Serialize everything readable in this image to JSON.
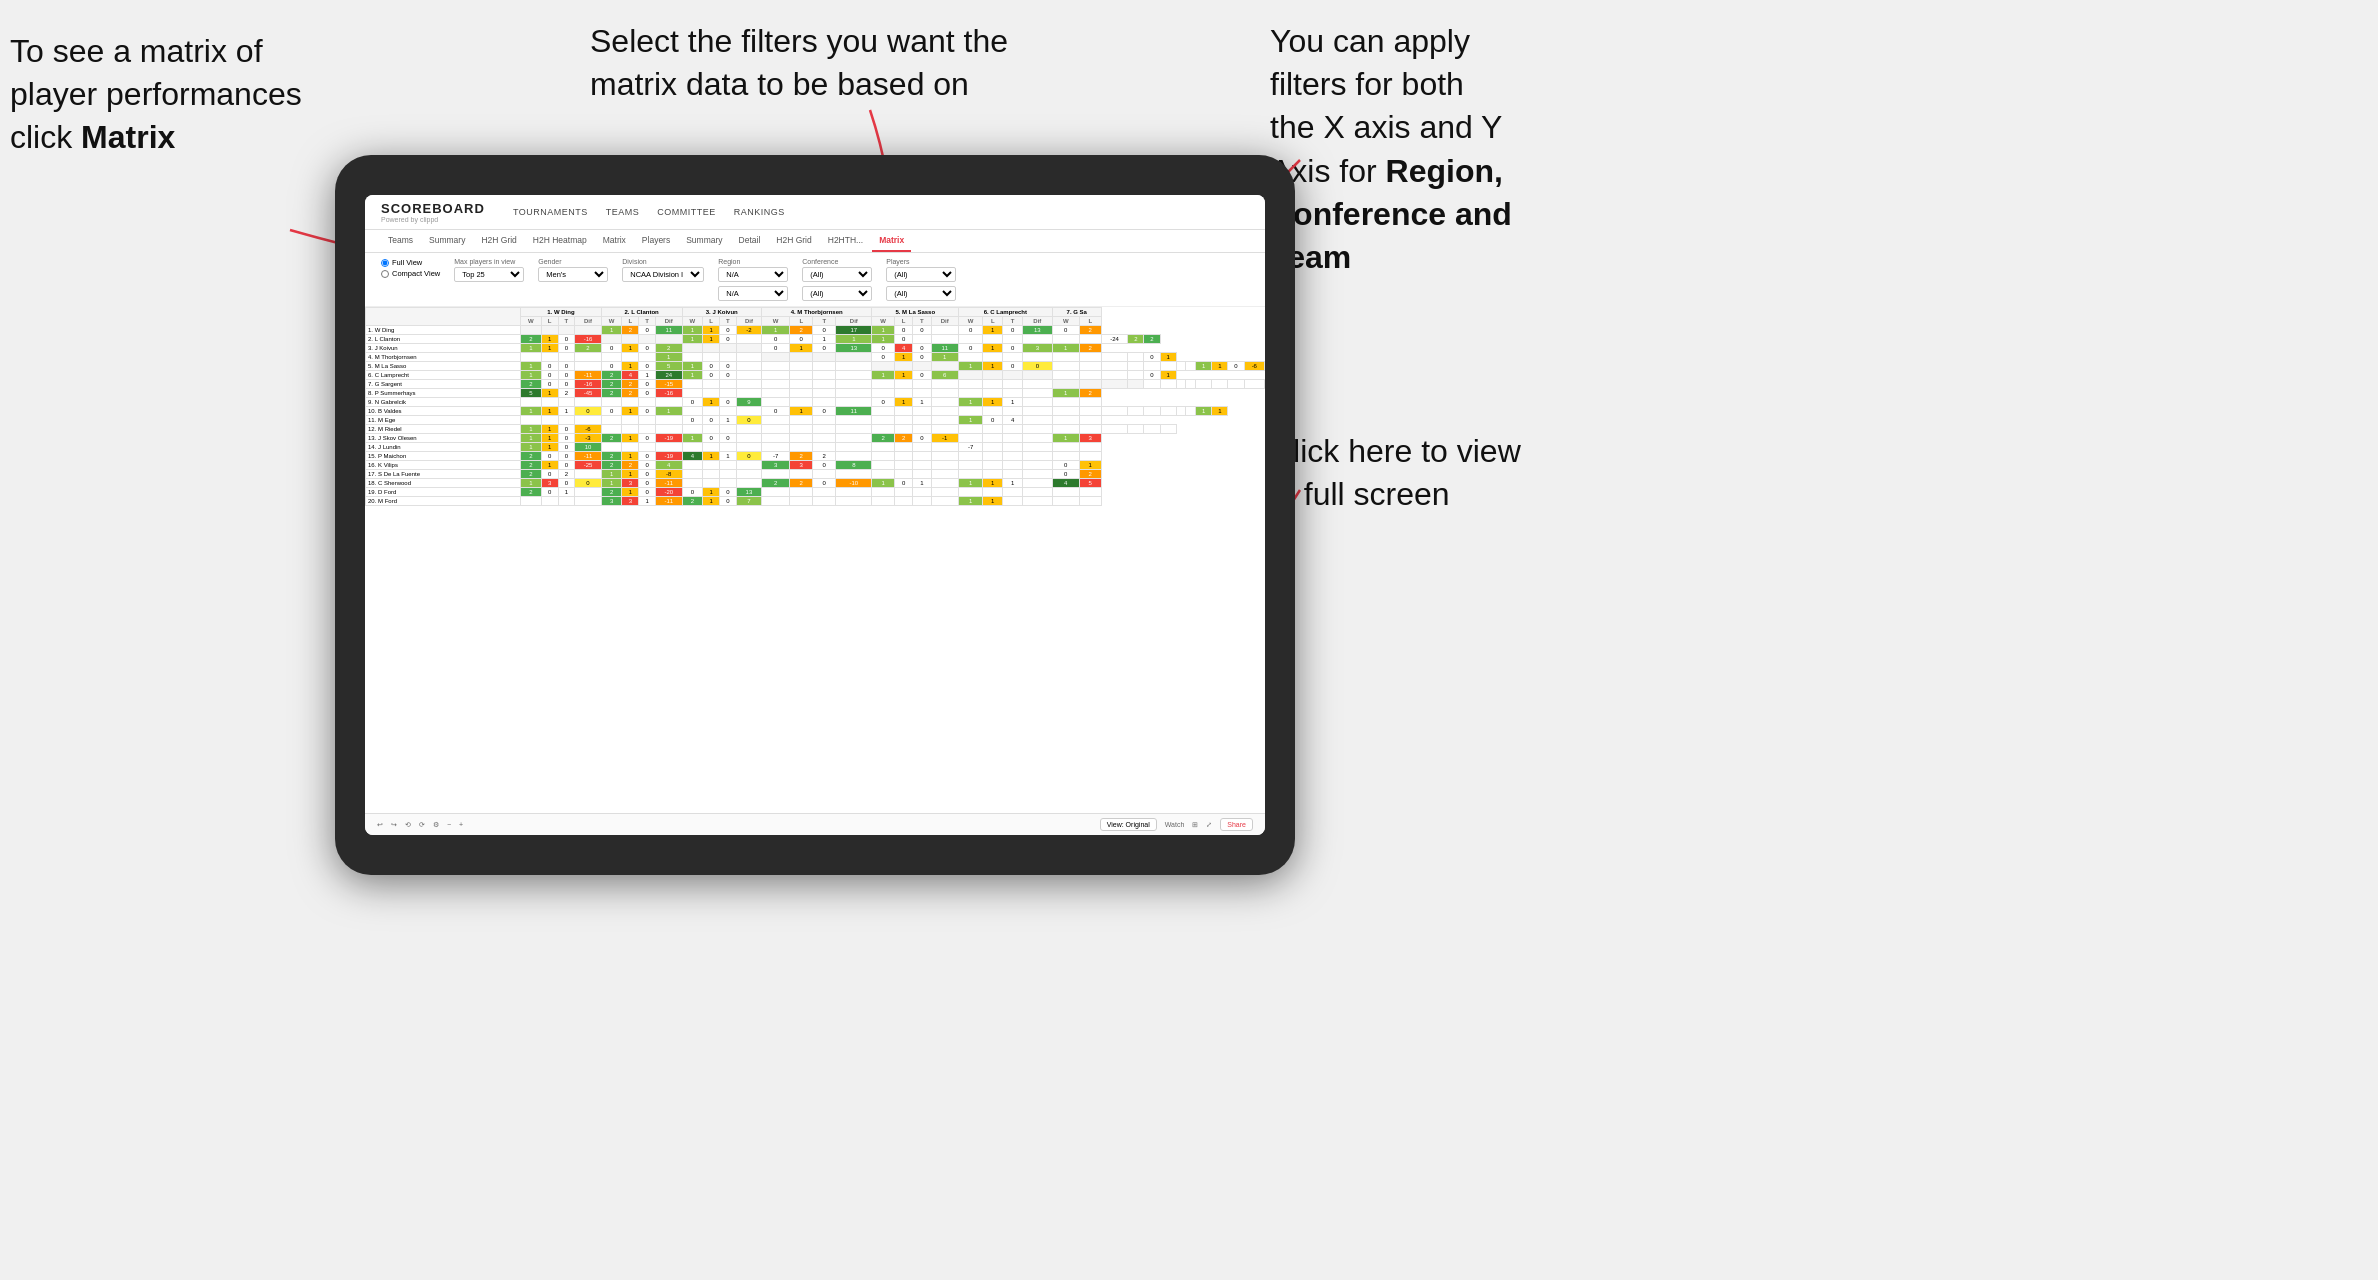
{
  "annotations": {
    "left": {
      "line1": "To see a matrix of",
      "line2": "player performances",
      "line3_normal": "click ",
      "line3_bold": "Matrix"
    },
    "center": {
      "text": "Select the filters you want the matrix data to be based on"
    },
    "right": {
      "line1": "You  can apply",
      "line2": "filters for both",
      "line3": "the X axis and Y",
      "line4_normal": "Axis for ",
      "line4_bold": "Region,",
      "line5_bold": "Conference and",
      "line6_bold": "Team"
    },
    "bottom_right": {
      "line1": "Click here to view",
      "line2": "in full screen"
    }
  },
  "app": {
    "logo": "SCOREBOARD",
    "logo_sub": "Powered by clippd",
    "nav": [
      "TOURNAMENTS",
      "TEAMS",
      "COMMITTEE",
      "RANKINGS"
    ],
    "sub_nav": [
      "Teams",
      "Summary",
      "H2H Grid",
      "H2H Heatmap",
      "Matrix",
      "Players",
      "Summary",
      "Detail",
      "H2H Grid",
      "H2HTH...",
      "Matrix"
    ],
    "active_tab": "Matrix",
    "filters": {
      "view": [
        "Full View",
        "Compact View"
      ],
      "max_players_label": "Max players in view",
      "max_players_value": "Top 25",
      "gender_label": "Gender",
      "gender_value": "Men's",
      "division_label": "Division",
      "division_value": "NCAA Division I",
      "region_label": "Region",
      "region_value": "N/A",
      "conference_label": "Conference",
      "conference_value": "(All)",
      "players_label": "Players",
      "players_value": "(All)"
    },
    "column_headers": [
      "1. W Ding",
      "2. L Clanton",
      "3. J Koivun",
      "4. M Thorbjornsen",
      "5. M La Sasso",
      "6. C Lamprecht",
      "7. G Sa"
    ],
    "sub_cols": [
      "W",
      "L",
      "T",
      "Dif"
    ],
    "rows": [
      {
        "name": "1. W Ding",
        "cells": [
          "",
          "",
          "",
          "",
          "1",
          "2",
          "0",
          "11",
          "1",
          "1",
          "0",
          "-2",
          "1",
          "2",
          "0",
          "17",
          "1",
          "0",
          "0",
          "",
          "0",
          "1",
          "0",
          "13",
          "0",
          "2"
        ]
      },
      {
        "name": "2. L Clanton",
        "cells": [
          "2",
          "1",
          "0",
          "-16",
          "",
          "",
          "",
          "",
          "1",
          "1",
          "0",
          "",
          "0",
          "0",
          "1",
          "1",
          "1",
          "0",
          "",
          "",
          "",
          "",
          "",
          "",
          "",
          "",
          "",
          "",
          "-24",
          "2",
          "2"
        ]
      },
      {
        "name": "3. J Koivun",
        "cells": [
          "1",
          "1",
          "0",
          "2",
          "0",
          "1",
          "0",
          "2",
          "",
          "",
          "",
          "",
          "0",
          "1",
          "0",
          "13",
          "0",
          "4",
          "0",
          "11",
          "0",
          "1",
          "0",
          "3",
          "1",
          "2"
        ]
      },
      {
        "name": "4. M Thorbjornsen",
        "cells": [
          "",
          "",
          "",
          "",
          "",
          "",
          "",
          "1",
          "",
          "",
          "",
          "",
          "",
          "",
          "",
          "",
          "0",
          "1",
          "0",
          "1",
          "",
          "",
          "",
          "",
          "",
          "",
          "",
          "",
          "0",
          "1"
        ]
      },
      {
        "name": "5. M La Sasso",
        "cells": [
          "1",
          "0",
          "0",
          "",
          "0",
          "1",
          "0",
          "5",
          "1",
          "0",
          "0",
          "",
          "",
          "",
          "",
          "",
          "",
          "",
          "",
          "",
          "1",
          "1",
          "0",
          "0",
          "",
          "",
          "",
          "",
          "",
          "",
          "",
          "",
          "1",
          "1",
          "0",
          "-6"
        ]
      },
      {
        "name": "6. C Lamprecht",
        "cells": [
          "1",
          "0",
          "0",
          "-11",
          "2",
          "4",
          "1",
          "24",
          "1",
          "0",
          "0",
          "",
          "",
          "",
          "",
          "",
          "1",
          "1",
          "0",
          "6",
          "",
          "",
          "",
          "",
          "",
          "",
          "",
          "",
          "0",
          "1"
        ]
      },
      {
        "name": "7. G Sargent",
        "cells": [
          "2",
          "0",
          "0",
          "-16",
          "2",
          "2",
          "0",
          "-15",
          "",
          "",
          "",
          "",
          "",
          "",
          "",
          "",
          "",
          "",
          "",
          "",
          "",
          "",
          "",
          "",
          "",
          "",
          "",
          "",
          "",
          "",
          "",
          "",
          "",
          "",
          "",
          ""
        ]
      },
      {
        "name": "8. P Summerhays",
        "cells": [
          "5",
          "1",
          "2",
          "-45",
          "2",
          "2",
          "0",
          "-16",
          "",
          "",
          "",
          "",
          "",
          "",
          "",
          "",
          "",
          "",
          "",
          "",
          "",
          "",
          "",
          "",
          "1",
          "2"
        ]
      },
      {
        "name": "9. N Gabrelcik",
        "cells": [
          "",
          "",
          "",
          "",
          "",
          "",
          "",
          "",
          "0",
          "1",
          "0",
          "9",
          "",
          "",
          "",
          "",
          "0",
          "1",
          "1",
          "",
          "1",
          "1",
          "1",
          ""
        ]
      },
      {
        "name": "10. B Valdes",
        "cells": [
          "1",
          "1",
          "1",
          "0",
          "0",
          "1",
          "0",
          "1",
          "",
          "",
          "",
          "",
          "0",
          "1",
          "0",
          "11",
          "",
          "",
          "",
          "",
          "",
          "",
          "",
          "",
          "",
          "",
          "",
          "",
          "",
          "",
          "",
          "",
          "1",
          "1"
        ]
      },
      {
        "name": "11. M Ege",
        "cells": [
          "",
          "",
          "",
          "",
          "",
          "",
          "",
          "",
          "0",
          "0",
          "1",
          "0",
          "",
          "",
          "",
          "",
          "",
          "",
          "",
          "",
          "1",
          "0",
          "4"
        ]
      },
      {
        "name": "12. M Riedel",
        "cells": [
          "1",
          "1",
          "0",
          "-6",
          "",
          "",
          "",
          "",
          "",
          "",
          "",
          "",
          "",
          "",
          "",
          "",
          "",
          "",
          "",
          "",
          "",
          "",
          "",
          "",
          "",
          "",
          "",
          "",
          "",
          "",
          "",
          "",
          "",
          ""
        ]
      },
      {
        "name": "13. J Skov Olesen",
        "cells": [
          "1",
          "1",
          "0",
          "-3",
          "2",
          "1",
          "0",
          "-19",
          "1",
          "0",
          "0",
          "",
          "",
          "",
          "",
          "",
          "2",
          "2",
          "0",
          "-1",
          "",
          "",
          "",
          "",
          "1",
          "3"
        ]
      },
      {
        "name": "14. J Lundin",
        "cells": [
          "1",
          "1",
          "0",
          "10",
          "",
          "",
          "",
          "",
          "",
          "",
          "",
          "",
          "",
          "",
          "",
          "",
          "",
          "",
          "",
          "",
          "-7"
        ]
      },
      {
        "name": "15. P Maichon",
        "cells": [
          "2",
          "0",
          "0",
          "-11",
          "2",
          "1",
          "0",
          "-19",
          "4",
          "1",
          "1",
          "0",
          "-7",
          "2",
          "2"
        ]
      },
      {
        "name": "16. K Vilips",
        "cells": [
          "2",
          "1",
          "0",
          "-25",
          "2",
          "2",
          "0",
          "4",
          "",
          "",
          "",
          "",
          "3",
          "3",
          "0",
          "8",
          "",
          "",
          "",
          "",
          "",
          "",
          "",
          "",
          "0",
          "1"
        ]
      },
      {
        "name": "17. S De La Fuente",
        "cells": [
          "2",
          "0",
          "2",
          "",
          "1",
          "1",
          "0",
          "-8",
          "",
          "",
          "",
          "",
          "",
          "",
          "",
          "",
          "",
          "",
          "",
          "",
          "",
          "",
          "",
          "",
          "0",
          "2"
        ]
      },
      {
        "name": "18. C Sherwood",
        "cells": [
          "1",
          "3",
          "0",
          "0",
          "1",
          "3",
          "0",
          "-11",
          "",
          "",
          "",
          "",
          "2",
          "2",
          "0",
          "-10",
          "1",
          "0",
          "1",
          "",
          "1",
          "1",
          "1",
          "",
          "4",
          "5"
        ]
      },
      {
        "name": "19. D Ford",
        "cells": [
          "2",
          "0",
          "1",
          "",
          "2",
          "1",
          "0",
          "-20",
          "0",
          "1",
          "0",
          "13",
          "",
          "",
          "",
          "",
          ""
        ]
      },
      {
        "name": "20. M Ford",
        "cells": [
          "",
          "",
          "",
          "",
          "3",
          "3",
          "1",
          "-11",
          "2",
          "1",
          "0",
          "7",
          "",
          "",
          "",
          "",
          "",
          "",
          "",
          "",
          "1",
          "1"
        ]
      }
    ]
  },
  "bottom_bar": {
    "view_original": "View: Original",
    "watch": "Watch",
    "share": "Share"
  }
}
